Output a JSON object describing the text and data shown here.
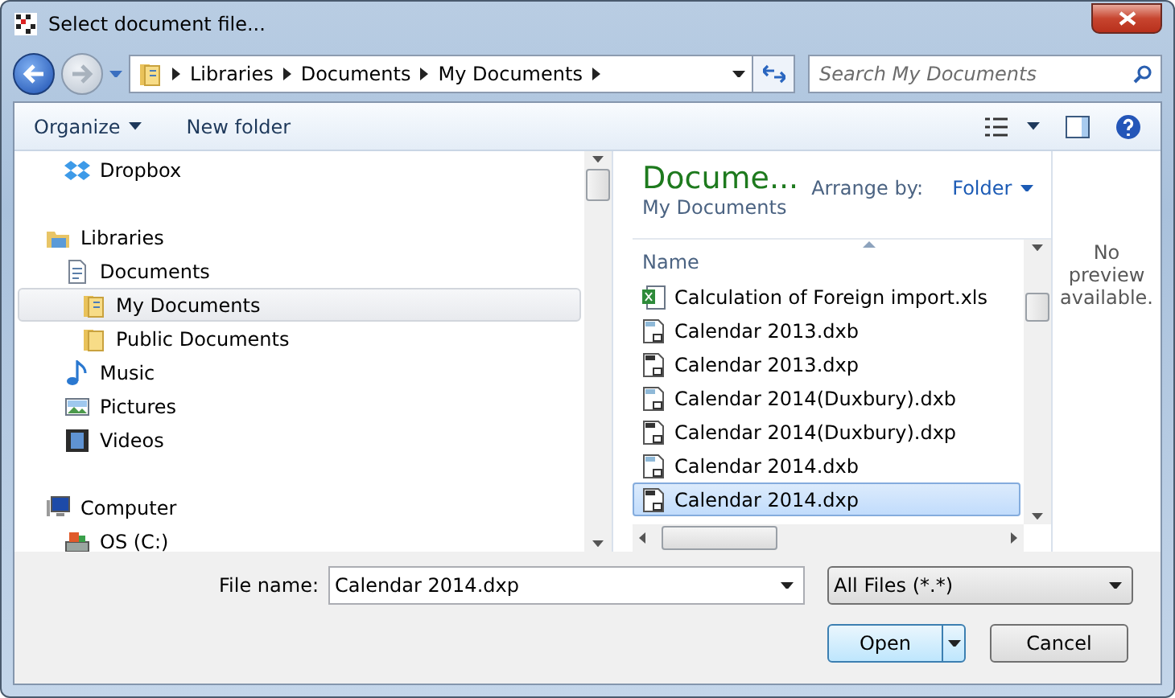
{
  "window": {
    "title": "Select document file..."
  },
  "address": {
    "crumbs": [
      "Libraries",
      "Documents",
      "My Documents"
    ]
  },
  "search": {
    "placeholder": "Search My Documents"
  },
  "toolbar": {
    "buttons": [
      {
        "label": "Organize",
        "dropdown": true
      },
      {
        "label": "New folder",
        "dropdown": false
      }
    ]
  },
  "nav": {
    "sections": [
      {
        "children": [
          {
            "label": "Dropbox",
            "kind": "dropbox",
            "selected": false
          }
        ]
      },
      {
        "label": "Libraries",
        "kind": "libraries",
        "selected": false,
        "children": [
          {
            "label": "Documents",
            "kind": "documents",
            "selected": false,
            "children": [
              {
                "label": "My Documents",
                "kind": "folder-doc",
                "selected": true
              },
              {
                "label": "Public Documents",
                "kind": "folder",
                "selected": false
              }
            ]
          },
          {
            "label": "Music",
            "kind": "music",
            "selected": false
          },
          {
            "label": "Pictures",
            "kind": "pictures",
            "selected": false
          },
          {
            "label": "Videos",
            "kind": "videos",
            "selected": false
          }
        ]
      },
      {
        "label": "Computer",
        "kind": "computer",
        "selected": false,
        "children": [
          {
            "label": "OS (C:)",
            "kind": "drive",
            "selected": false
          }
        ]
      }
    ]
  },
  "library": {
    "title": "Docume...",
    "subtitle": "My Documents",
    "arrange_label": "Arrange by:",
    "arrange_value": "Folder"
  },
  "files": {
    "column": "Name",
    "rows": [
      {
        "name": "Calculation of Foreign import.xls",
        "kind": "xls",
        "selected": false
      },
      {
        "name": "Calendar 2013.dxb",
        "kind": "dxb",
        "selected": false
      },
      {
        "name": "Calendar 2013.dxp",
        "kind": "dxp",
        "selected": false
      },
      {
        "name": "Calendar 2014(Duxbury).dxb",
        "kind": "dxb",
        "selected": false
      },
      {
        "name": "Calendar 2014(Duxbury).dxp",
        "kind": "dxp",
        "selected": false
      },
      {
        "name": "Calendar 2014.dxb",
        "kind": "dxb",
        "selected": false
      },
      {
        "name": "Calendar 2014.dxp",
        "kind": "dxp",
        "selected": true
      }
    ]
  },
  "preview": {
    "message": "No preview available."
  },
  "footer": {
    "filename_label": "File name:",
    "filename": "Calendar 2014.dxp",
    "filter": "All Files (*.*)",
    "open": "Open",
    "cancel": "Cancel"
  }
}
